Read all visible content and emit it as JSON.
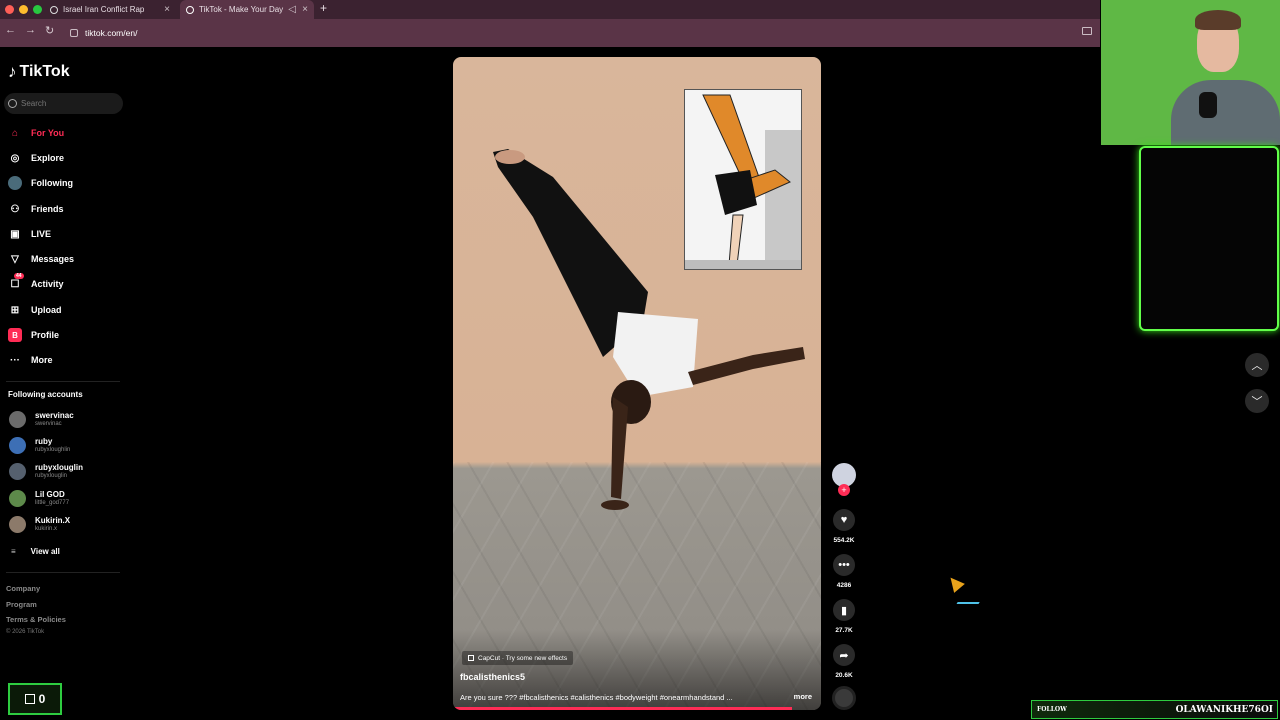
{
  "browser": {
    "tabs": [
      {
        "title": "Israel Iran Conflict Rap"
      },
      {
        "title": "TikTok - Make Your Day"
      }
    ],
    "url": "tiktok.com/en/"
  },
  "sidebar": {
    "brand": "TikTok",
    "search_placeholder": "Search",
    "nav": [
      {
        "label": "For You",
        "icon": "home-icon",
        "active": true
      },
      {
        "label": "Explore",
        "icon": "compass-icon"
      },
      {
        "label": "Following",
        "icon": "following-avatar-icon"
      },
      {
        "label": "Friends",
        "icon": "friends-icon"
      },
      {
        "label": "LIVE",
        "icon": "live-icon"
      },
      {
        "label": "Messages",
        "icon": "messages-icon"
      },
      {
        "label": "Activity",
        "icon": "activity-icon",
        "badge": "44"
      },
      {
        "label": "Upload",
        "icon": "upload-icon"
      },
      {
        "label": "Profile",
        "icon": "profile-icon"
      },
      {
        "label": "More",
        "icon": "more-icon"
      }
    ],
    "following_title": "Following accounts",
    "accounts": [
      {
        "name": "swervinac",
        "handle": "swervinac"
      },
      {
        "name": "ruby",
        "handle": "rubyxloughlin"
      },
      {
        "name": "rubyxlouglin",
        "handle": "rubyxlouglin"
      },
      {
        "name": "Lil GOD",
        "handle": "little_god777"
      },
      {
        "name": "Kukirin.X",
        "handle": "kukirin.x"
      }
    ],
    "view_all": "View all",
    "footer_links": [
      "Company",
      "Program",
      "Terms & Policies"
    ],
    "copyright": "© 2026 TikTok"
  },
  "video": {
    "effect_label": "CapCut · Try some new effects",
    "author": "fbcalisthenics5",
    "caption": "Are you sure ??? #fbcalisthenics #calisthenics #bodyweight #onearmhandstand ...",
    "more": "more",
    "progress_fraction": 0.92
  },
  "actions": {
    "likes": "554.2K",
    "comments": "4286",
    "saves": "27.7K",
    "shares": "20.6K"
  },
  "overlay": {
    "follow_count": "0",
    "follow_label": "FOLLOW",
    "follow_name": "OLAWANIKHE76OI"
  },
  "colors": {
    "accent": "#ff2c55",
    "stream_green": "#2ecc40"
  }
}
